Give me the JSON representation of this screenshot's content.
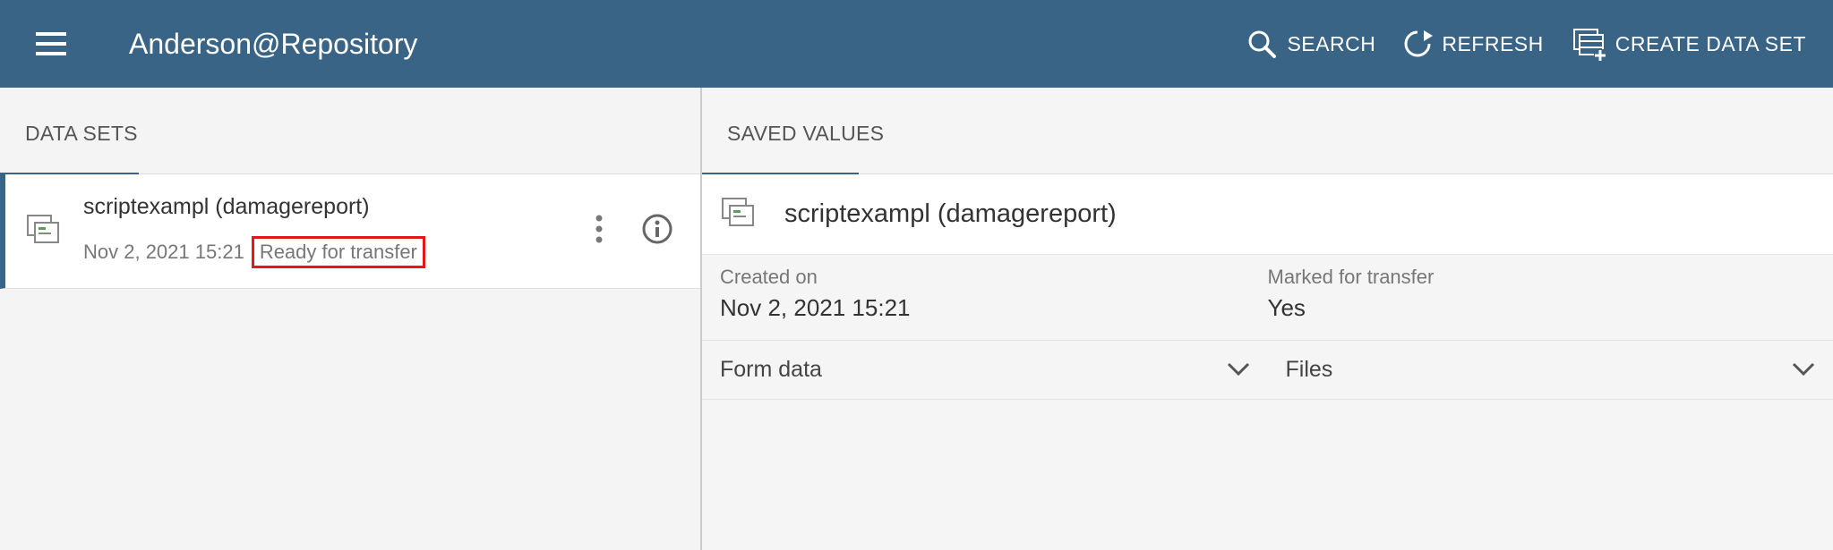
{
  "header": {
    "title": "Anderson@Repository",
    "actions": {
      "search": "SEARCH",
      "refresh": "REFRESH",
      "create": "CREATE DATA SET"
    }
  },
  "left": {
    "heading": "DATA SETS",
    "item": {
      "title": "scriptexampl (damagereport)",
      "timestamp": "Nov 2, 2021 15:21",
      "status": "Ready for transfer"
    }
  },
  "right": {
    "heading": "SAVED VALUES",
    "title": "scriptexampl (damagereport)",
    "created_label": "Created on",
    "created_value": "Nov 2, 2021 15:21",
    "marked_label": "Marked for transfer",
    "marked_value": "Yes",
    "form_data": "Form data",
    "files": "Files"
  }
}
